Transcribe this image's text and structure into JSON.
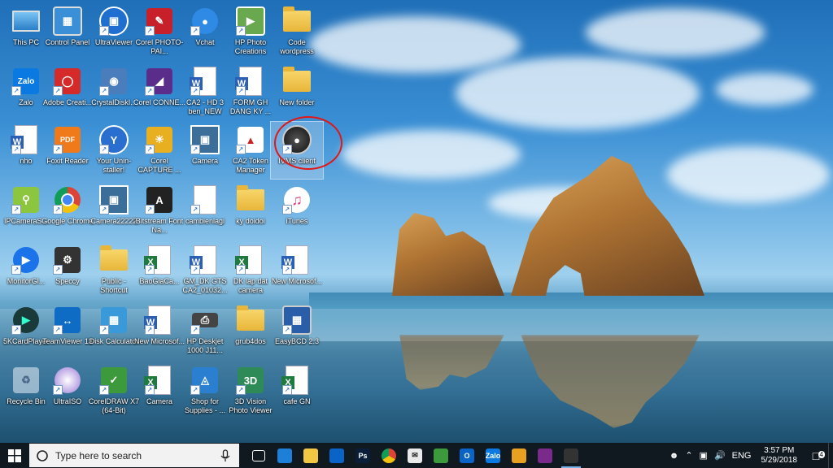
{
  "desktop": {
    "icons": [
      {
        "label": "This PC",
        "icon": "this-pc-icon"
      },
      {
        "label": "Control Panel",
        "icon": "control-panel-icon"
      },
      {
        "label": "UltraViewer",
        "icon": "ultraviewer-icon"
      },
      {
        "label": "Corel PHOTO-PAI...",
        "icon": "corel-photo-paint-icon"
      },
      {
        "label": "Vchat",
        "icon": "vchat-icon"
      },
      {
        "label": "HP Photo Creations",
        "icon": "hp-photo-creations-icon"
      },
      {
        "label": "Code wordpress",
        "icon": "folder-icon"
      },
      {
        "label": "Zalo",
        "icon": "zalo-icon"
      },
      {
        "label": "Adobe Creati...",
        "icon": "adobe-creative-cloud-icon"
      },
      {
        "label": "CrystalDiskI...",
        "icon": "crystaldiskinfo-icon"
      },
      {
        "label": "Corel CONNE...",
        "icon": "corel-connect-icon"
      },
      {
        "label": "CA2 - HD 3 ben_NEW",
        "icon": "word-document-icon"
      },
      {
        "label": "FORM GH DANG KY ...",
        "icon": "word-document-icon"
      },
      {
        "label": "New folder",
        "icon": "folder-icon"
      },
      {
        "label": "nho",
        "icon": "word-document-icon"
      },
      {
        "label": "Foxit Reader",
        "icon": "foxit-reader-icon"
      },
      {
        "label": "Your Unin-staller!",
        "icon": "your-uninstaller-icon"
      },
      {
        "label": "Corel CAPTURE ...",
        "icon": "corel-capture-icon"
      },
      {
        "label": "Camera",
        "icon": "camera-image-icon"
      },
      {
        "label": "CA2 Token Manager",
        "icon": "ca2-token-manager-icon"
      },
      {
        "label": "IVMS client",
        "icon": "ivms-client-icon"
      },
      {
        "label": "IPCameraS...",
        "icon": "ipcamera-search-icon"
      },
      {
        "label": "Google Chrome",
        "icon": "chrome-icon"
      },
      {
        "label": "Camera22222",
        "icon": "camera-image-icon"
      },
      {
        "label": "Bitstream Font Na...",
        "icon": "bitstream-font-navigator-icon"
      },
      {
        "label": "cambienlagi",
        "icon": "text-document-icon"
      },
      {
        "label": "ky doidoi",
        "icon": "folder-icon"
      },
      {
        "label": "iTunes",
        "icon": "itunes-icon"
      },
      {
        "label": "MonitorGl...",
        "icon": "monitor-icon"
      },
      {
        "label": "Speccy",
        "icon": "speccy-icon"
      },
      {
        "label": "Public - Shortcut",
        "icon": "folder-icon"
      },
      {
        "label": "BaoGiaCa...",
        "icon": "excel-document-icon"
      },
      {
        "label": "GM_DK GTS CA2_01032...",
        "icon": "word-document-icon"
      },
      {
        "label": "DK lap dat camera",
        "icon": "excel-document-icon"
      },
      {
        "label": "New Microsof...",
        "icon": "word-document-icon"
      },
      {
        "label": "5KCardPlayer",
        "icon": "card-player-icon"
      },
      {
        "label": "TeamViewer 13",
        "icon": "teamviewer-icon"
      },
      {
        "label": "Disk Calculator",
        "icon": "disk-calculator-icon"
      },
      {
        "label": "New Microsof...",
        "icon": "word-document-icon"
      },
      {
        "label": "HP Deskjet 1000 J11...",
        "icon": "printer-icon"
      },
      {
        "label": "grub4dos",
        "icon": "folder-icon"
      },
      {
        "label": "EasyBCD 2.3",
        "icon": "easybcd-icon"
      },
      {
        "label": "Recycle Bin",
        "icon": "recycle-bin-icon"
      },
      {
        "label": "UltraISO",
        "icon": "ultraiso-icon"
      },
      {
        "label": "CorelDRAW X7 (64-Bit)",
        "icon": "coreldraw-icon"
      },
      {
        "label": "Camera",
        "icon": "excel-document-icon"
      },
      {
        "label": "Shop for Supplies - ...",
        "icon": "shop-supplies-icon"
      },
      {
        "label": "3D Vision Photo Viewer",
        "icon": "3d-vision-icon"
      },
      {
        "label": "cafe GN",
        "icon": "excel-document-icon"
      }
    ]
  },
  "taskbar": {
    "search_placeholder": "Type here to search",
    "pinned": [
      {
        "name": "task-view-icon"
      },
      {
        "name": "edge-icon"
      },
      {
        "name": "file-explorer-icon"
      },
      {
        "name": "store-icon"
      },
      {
        "name": "photoshop-icon",
        "text": "Ps"
      },
      {
        "name": "chrome-icon"
      },
      {
        "name": "mail-icon"
      },
      {
        "name": "coreldraw-icon"
      },
      {
        "name": "outlook-icon",
        "text": "O"
      },
      {
        "name": "zalo-icon",
        "text": "Zalo"
      },
      {
        "name": "paint-icon"
      },
      {
        "name": "winrar-icon"
      },
      {
        "name": "ivms-client-icon"
      }
    ],
    "tray": {
      "language": "ENG",
      "time": "3:57 PM",
      "date": "5/29/2018",
      "notifications": "4"
    }
  }
}
